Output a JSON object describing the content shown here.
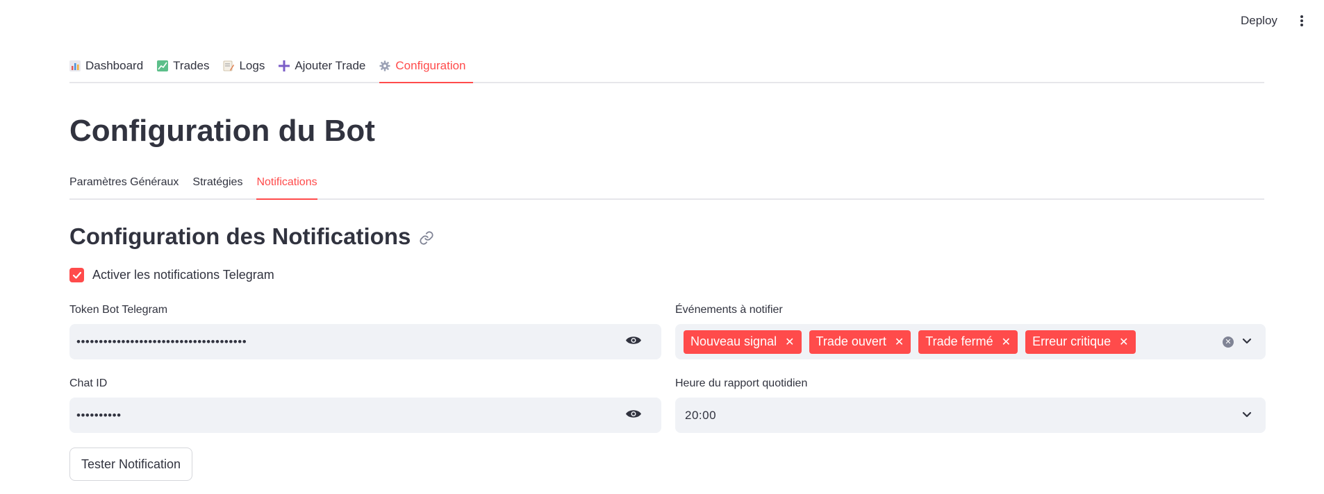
{
  "header": {
    "deploy_label": "Deploy",
    "menu_icon": "kebab-menu-icon"
  },
  "nav": {
    "tabs": [
      {
        "label": "Dashboard",
        "icon": "bar-chart-icon",
        "color": "#d76b6b"
      },
      {
        "label": "Trades",
        "icon": "chart-increasing-icon",
        "color": "#4caf7d"
      },
      {
        "label": "Logs",
        "icon": "memo-icon",
        "color": "#e09a6a"
      },
      {
        "label": "Ajouter Trade",
        "icon": "plus-icon",
        "color": "#7b5ec7"
      },
      {
        "label": "Configuration",
        "icon": "gear-icon",
        "color": "#9aa0b4"
      }
    ],
    "active": "Configuration"
  },
  "page": {
    "title": "Configuration du Bot"
  },
  "subtabs": {
    "items": [
      "Paramètres Généraux",
      "Stratégies",
      "Notifications"
    ],
    "active": "Notifications"
  },
  "section": {
    "title": "Configuration des Notifications",
    "link_icon": "link-icon"
  },
  "telegram_toggle": {
    "label": "Activer les notifications Telegram",
    "checked": true
  },
  "token_field": {
    "label": "Token Bot Telegram",
    "value": "••••••••••••••••••••••••••••••••••••••",
    "icon": "eye-icon"
  },
  "chat_field": {
    "label": "Chat ID",
    "value": "••••••••••",
    "icon": "eye-icon"
  },
  "events_field": {
    "label": "Événements à notifier",
    "tags": [
      "Nouveau signal",
      "Trade ouvert",
      "Trade fermé",
      "Erreur critique"
    ],
    "clear_icon": "clear-icon",
    "dropdown_icon": "chevron-down-icon"
  },
  "report_time": {
    "label": "Heure du rapport quotidien",
    "value": "20:00",
    "dropdown_icon": "chevron-down-icon"
  },
  "test_button": {
    "label": "Tester Notification"
  },
  "colors": {
    "accent": "#ff4b4b",
    "text": "#31333f",
    "field_bg": "#f0f2f6",
    "border": "#e6e6ea"
  }
}
